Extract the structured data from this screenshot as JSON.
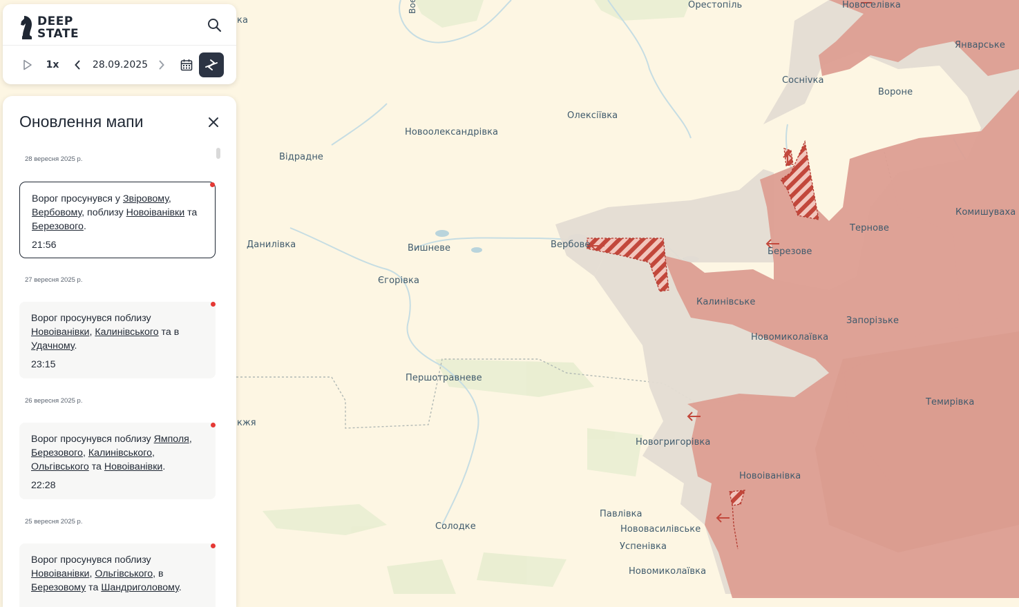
{
  "app": {
    "logo_line1": "DEEP",
    "logo_line2": "STATE"
  },
  "controls": {
    "speed": "1x",
    "date": "28.09.2025"
  },
  "panel": {
    "title": "Оновлення мапи"
  },
  "updates": [
    {
      "date": "28 вересня 2025 р.",
      "parts": [
        {
          "t": "Ворог просунувся у "
        },
        {
          "t": "Звіровому",
          "link": true
        },
        {
          "t": ", "
        },
        {
          "t": "Вербовому",
          "link": true
        },
        {
          "t": ", поблизу "
        },
        {
          "t": "Новоіванівки",
          "link": true
        },
        {
          "t": " та "
        },
        {
          "t": "Березового",
          "link": true
        },
        {
          "t": "."
        }
      ],
      "time": "21:56",
      "active": true
    },
    {
      "date": "27 вересня 2025 р.",
      "parts": [
        {
          "t": "Ворог просунувся поблизу "
        },
        {
          "t": "Новоіванівки",
          "link": true
        },
        {
          "t": ", "
        },
        {
          "t": "Калинівського",
          "link": true
        },
        {
          "t": " та в "
        },
        {
          "t": "Удачному",
          "link": true
        },
        {
          "t": "."
        }
      ],
      "time": "23:15",
      "active": false
    },
    {
      "date": "26 вересня 2025 р.",
      "parts": [
        {
          "t": "Ворог просунувся поблизу "
        },
        {
          "t": "Ямполя",
          "link": true
        },
        {
          "t": ", "
        },
        {
          "t": "Березового",
          "link": true
        },
        {
          "t": ", "
        },
        {
          "t": "Калинівського",
          "link": true
        },
        {
          "t": ", "
        },
        {
          "t": "Ольгівського",
          "link": true
        },
        {
          "t": " та "
        },
        {
          "t": "Новоіванівки",
          "link": true
        },
        {
          "t": "."
        }
      ],
      "time": "22:28",
      "active": false
    },
    {
      "date": "25 вересня 2025 р.",
      "parts": [
        {
          "t": "Ворог просунувся поблизу "
        },
        {
          "t": "Новоіванівки",
          "link": true
        },
        {
          "t": ", "
        },
        {
          "t": "Ольгівського",
          "link": true
        },
        {
          "t": ", в "
        },
        {
          "t": "Березовому",
          "link": true
        },
        {
          "t": " та "
        },
        {
          "t": "Шандриголовому",
          "link": true
        },
        {
          "t": "."
        }
      ],
      "time": "",
      "active": false
    }
  ],
  "map": {
    "occupied_color": "#dd9e92",
    "grey_zone_color": "#e4dcd3",
    "base_color": "#fdf6e3",
    "places": [
      "Орестопіль",
      "Новоселівка",
      "Январське",
      "Сосніvка",
      "Вороне",
      "Олексіївка",
      "Новоолександрівка",
      "Відрадне",
      "Данилівка",
      "Вишневе",
      "Вербове",
      "Березове",
      "Тернове",
      "Комишуваха",
      "Єгорівка",
      "Калинівське",
      "Запорізьке",
      "Новомиколаївка",
      "Першотравневе",
      "Темирівка",
      "Новогригорівка",
      "Новоіванівка",
      "Павлівка",
      "Нововасилівське",
      "Солодке",
      "Успенівка",
      "Новомиколаївка",
      "ка",
      "кжя",
      "Вое"
    ]
  }
}
